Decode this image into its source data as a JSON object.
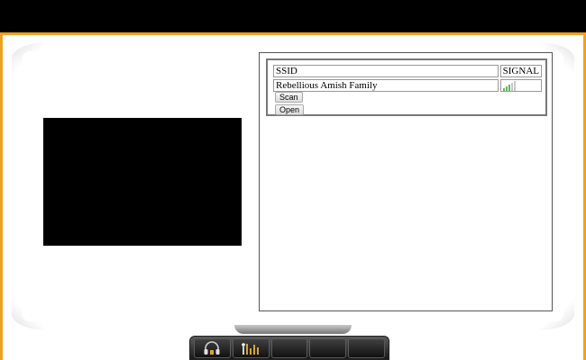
{
  "wifi": {
    "columns": {
      "ssid": "SSID",
      "signal": "SIGNAL"
    },
    "networks": [
      {
        "ssid": "Rebellious Amish Family",
        "signal_bars": 3,
        "signal_max": 5
      }
    ],
    "buttons": {
      "scan": "Scan",
      "open": "Open"
    }
  },
  "dock": {
    "items": [
      {
        "icon": "headphones-icon"
      },
      {
        "icon": "equalizer-icon"
      },
      {
        "icon": ""
      },
      {
        "icon": ""
      },
      {
        "icon": ""
      }
    ]
  },
  "colors": {
    "accent": "#f0a020",
    "signal_on": "#5cb85c",
    "signal_off": "#c8c8c8"
  }
}
